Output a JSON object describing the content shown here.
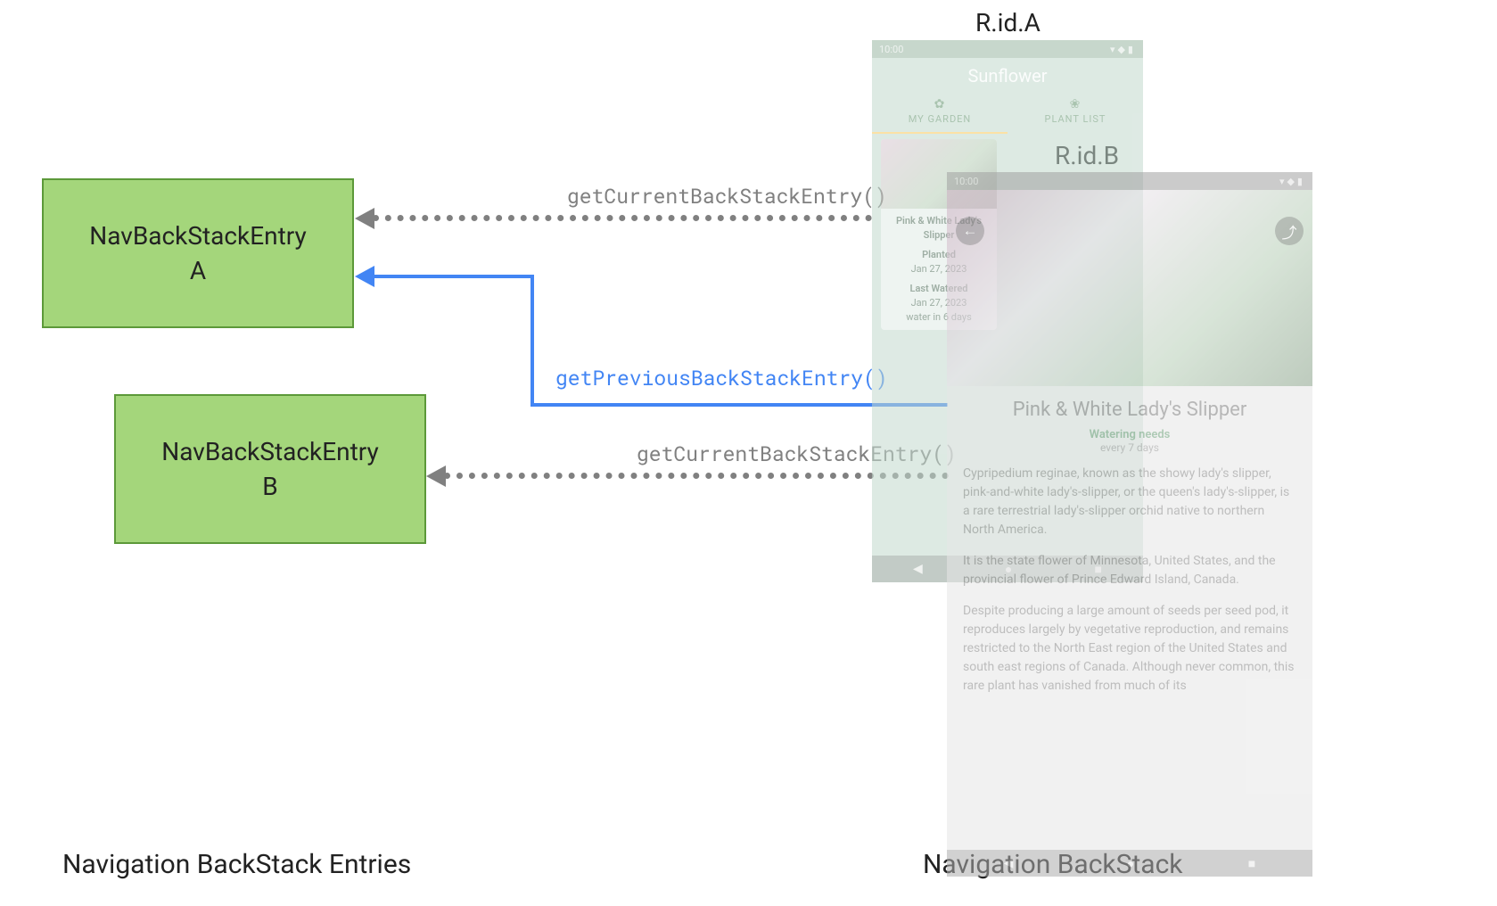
{
  "entries": {
    "a": "NavBackStackEntry\nA",
    "b": "NavBackStackEntry\nB"
  },
  "methods": {
    "current": "getCurrentBackStackEntry()",
    "previous": "getPreviousBackStackEntry()"
  },
  "captions": {
    "left": "Navigation BackStack Entries",
    "right": "Navigation BackStack"
  },
  "rid": {
    "a": "R.id.A",
    "b": "R.id.B"
  },
  "phoneA": {
    "time": "10:00",
    "appTitle": "Sunflower",
    "tabs": {
      "garden": "MY GARDEN",
      "plantlist": "PLANT LIST"
    },
    "card": {
      "title": "Pink & White Lady's Slipper",
      "plantedLabel": "Planted",
      "plantedDate": "Jan 27, 2023",
      "wateredLabel": "Last Watered",
      "wateredDate": "Jan 27, 2023",
      "wateredNote": "water in 6 days"
    }
  },
  "phoneB": {
    "time": "10:00",
    "title": "Pink & White Lady's Slipper",
    "wateringLabel": "Watering needs",
    "wateringValue": "every 7 days",
    "p1": "Cypripedium reginae, known as the showy lady's slipper, pink-and-white lady's-slipper, or the queen's lady's-slipper, is a rare terrestrial lady's-slipper orchid native to northern North America.",
    "p2": "It is the state flower of Minnesota, United States, and the provincial flower of Prince Edward Island, Canada.",
    "p3": "Despite producing a large amount of seeds per seed pod, it reproduces largely by vegetative reproduction, and remains restricted to the North East region of the United States and south east regions of Canada. Although never common, this rare plant has vanished from much of its"
  }
}
